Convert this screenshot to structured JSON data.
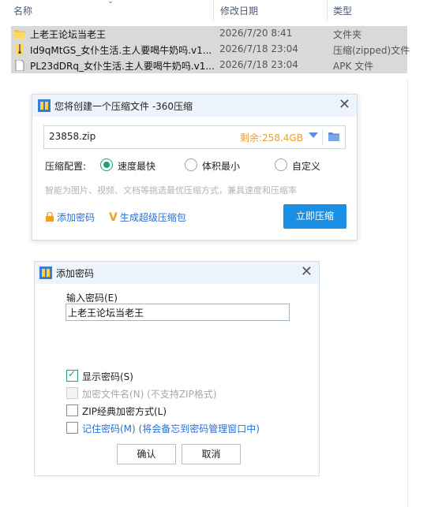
{
  "explorer": {
    "columns": {
      "name": "名称",
      "date": "修改日期",
      "type": "类型"
    },
    "files": [
      {
        "name": "上老王论坛当老王",
        "date": "2026/7/20 8:41",
        "type": "文件夹",
        "icon": "folder-icon"
      },
      {
        "name": "Id9qMtGS_女仆生活.主人要喝牛奶吗.v1...",
        "date": "2026/7/18 23:04",
        "type": "压缩(zipped)文件",
        "icon": "zip-icon"
      },
      {
        "name": "PL23dDRq_女仆生活.主人要喝牛奶吗.v1...",
        "date": "2026/7/18 23:04",
        "type": "APK 文件",
        "icon": "apk-file-icon"
      }
    ]
  },
  "compress_dialog": {
    "title": "您将创建一个压缩文件 -360压缩",
    "filename": "23858.zip",
    "free_space": "剩余:258.4GB",
    "config_label": "压缩配置:",
    "options": [
      {
        "label": "速度最快",
        "selected": true
      },
      {
        "label": "体积最小",
        "selected": false
      },
      {
        "label": "自定义",
        "selected": false
      }
    ],
    "hint": "智能为图片、视频、文档等挑选最优压缩方式，兼具速度和压缩率",
    "add_password": "添加密码",
    "super_package": "生成超级压缩包",
    "compress_button": "立即压缩",
    "accent": "#1a8fe6"
  },
  "password_dialog": {
    "title": "添加密码",
    "input_label": "输入密码(E)",
    "password_value": "上老王论坛当老王",
    "checkboxes": [
      {
        "label": "显示密码(S)",
        "checked": true,
        "disabled": false
      },
      {
        "label": "加密文件名(N) (不支持ZIP格式)",
        "checked": false,
        "disabled": true
      },
      {
        "label": "ZIP经典加密方式(L)",
        "checked": false,
        "disabled": false
      },
      {
        "label": "记住密码(M) (将会备忘到密码管理窗口中)",
        "checked": false,
        "disabled": false
      }
    ],
    "ok_button": "确认",
    "cancel_button": "取消"
  }
}
